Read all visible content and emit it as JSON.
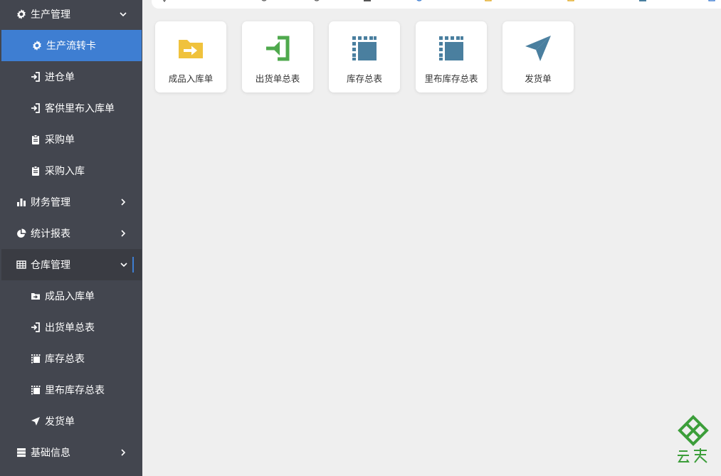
{
  "sidebar": {
    "items": [
      {
        "label": "生产管理",
        "icon": "settings-gear-icon",
        "expanded": true
      },
      {
        "label": "生产流转卡",
        "icon": "settings-gear-icon",
        "selected": true
      },
      {
        "label": "进仓单",
        "icon": "sign-in-icon"
      },
      {
        "label": "客供里布入库单",
        "icon": "sign-in-icon"
      },
      {
        "label": "采购单",
        "icon": "clipboard-icon"
      },
      {
        "label": "采购入库",
        "icon": "clipboard-icon"
      },
      {
        "label": "财务管理",
        "icon": "bar-chart-icon",
        "expanded": false
      },
      {
        "label": "统计报表",
        "icon": "pie-chart-icon",
        "expanded": false
      },
      {
        "label": "仓库管理",
        "icon": "table-grid-icon",
        "expanded": true
      },
      {
        "label": "成品入库单",
        "icon": "folder-arrow-icon"
      },
      {
        "label": "出货单总表",
        "icon": "sign-in-icon"
      },
      {
        "label": "库存总表",
        "icon": "dotted-square-icon"
      },
      {
        "label": "里布库存总表",
        "icon": "dotted-square-icon"
      },
      {
        "label": "发货单",
        "icon": "paper-plane-icon"
      },
      {
        "label": "基础信息",
        "icon": "server-list-icon",
        "expanded": false
      }
    ]
  },
  "main": {
    "cards": [
      {
        "label": "成品入库单",
        "icon": "folder-arrow-icon",
        "color": "#f0c23c"
      },
      {
        "label": "出货单总表",
        "icon": "sign-in-icon",
        "color": "#4fa94d"
      },
      {
        "label": "库存总表",
        "icon": "dotted-square-icon",
        "color": "#4a7f9f"
      },
      {
        "label": "里布库存总表",
        "icon": "dotted-square-icon",
        "color": "#4a7f9f"
      },
      {
        "label": "发货单",
        "icon": "paper-plane-icon",
        "color": "#4a7f9f"
      }
    ]
  },
  "logo": {
    "text": "云表",
    "color": "#3c9e3a"
  },
  "colors": {
    "sidebar_bg": "#43464f",
    "selected_bg": "#3e7ed2",
    "page_bg": "#efefef"
  }
}
